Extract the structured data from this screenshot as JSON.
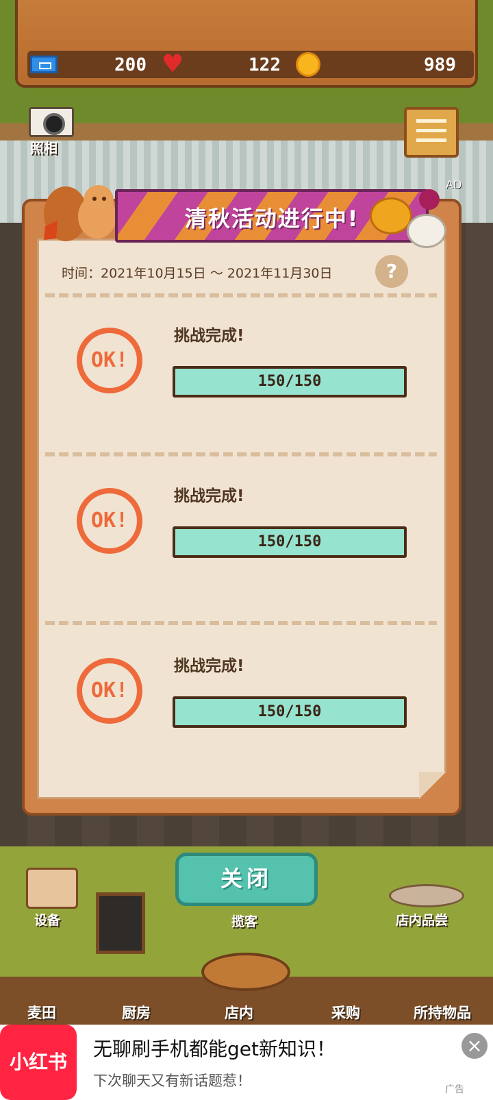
{
  "resources": {
    "tickets": "200",
    "hearts": "122",
    "coins": "989",
    "ticket_icon": "ticket-icon",
    "heart_icon": "heart-icon",
    "coin_icon": "coin-icon"
  },
  "camera": {
    "label": "照相",
    "icon": "camera-icon"
  },
  "menu": {
    "icon": "menu-icon",
    "ad_badge": "AD"
  },
  "event": {
    "title": "清秋活动进行中!",
    "date_range": "时间：2021年10月15日 ～ 2021年11月30日",
    "help_label": "?",
    "stamp_text": "OK!",
    "challenges": [
      {
        "label": "挑战完成!",
        "progress_text": "150/150",
        "current": 150,
        "total": 150
      },
      {
        "label": "挑战完成!",
        "progress_text": "150/150",
        "current": 150,
        "total": 150
      },
      {
        "label": "挑战完成!",
        "progress_text": "150/150",
        "current": 150,
        "total": 150
      }
    ]
  },
  "close_button": "关闭",
  "floor": {
    "equipment": "设备",
    "attract": "揽客",
    "tasting": "店内品尝"
  },
  "nav": [
    "麦田",
    "厨房",
    "店内",
    "采购",
    "所持物品"
  ],
  "ad": {
    "logo_text": "小红书",
    "title": "无聊刷手机都能get新知识！",
    "subtitle": "下次聊天又有新话题惹！",
    "tag": "广告",
    "close_icon": "close-icon"
  },
  "colors": {
    "banner_purple": "#c0449c",
    "banner_orange": "#e88e36",
    "progress_fill": "#96e3d0",
    "stamp": "#ee6a3b",
    "close_button": "#55c2ad",
    "ad_brand": "#ff2442"
  }
}
